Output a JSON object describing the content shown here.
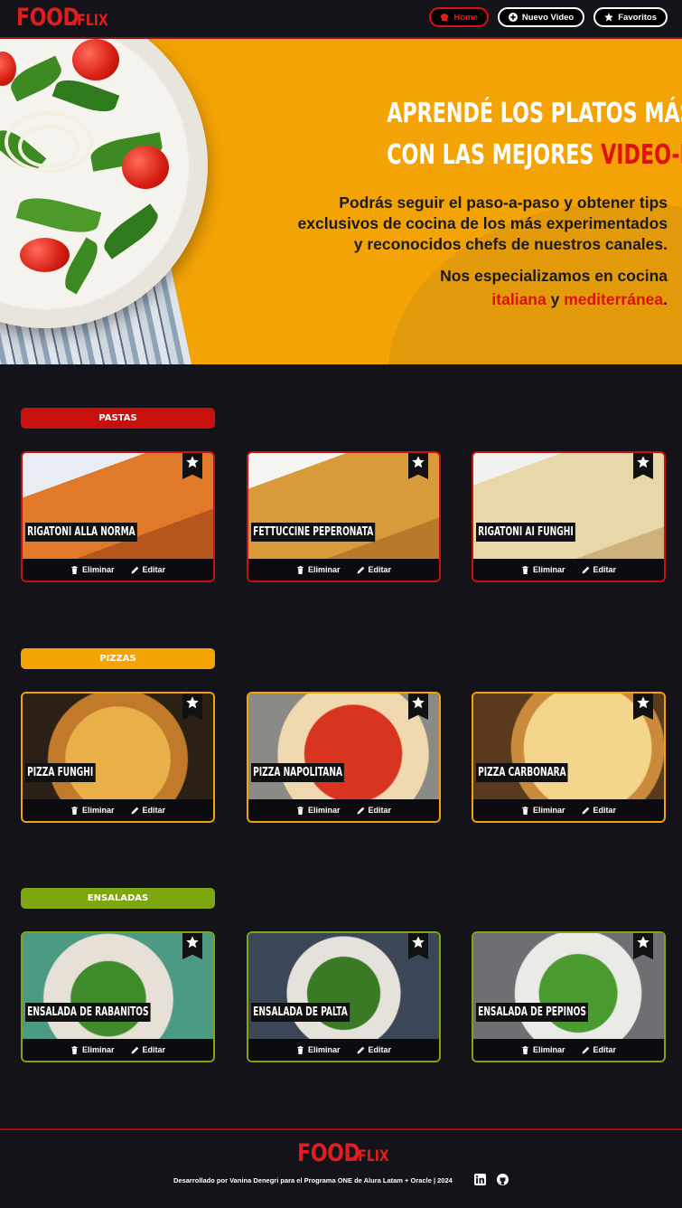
{
  "brand": {
    "food": "FOOD",
    "flix": ".FLIX",
    "red": "#e11d1d"
  },
  "nav": [
    {
      "label": "Home",
      "icon": "chef-hat-icon",
      "active": true
    },
    {
      "label": "Nuevo Video",
      "icon": "plus-circle-icon",
      "active": false
    },
    {
      "label": "Favoritos",
      "icon": "star-icon",
      "active": false
    }
  ],
  "hero": {
    "line1": "Aprendé los platos más ricos",
    "line2_a": "con las mejores ",
    "line2_b": "video-recetas",
    "paragraph": "Podrás seguir el paso-a-paso y obtener tips exclusivos de cocina de los más experimentados y reconocidos chefs de nuestros canales.",
    "spec_a": "Nos especializamos en cocina",
    "spec_b": "italiana",
    "spec_c": " y ",
    "spec_d": "mediterránea",
    "spec_e": "."
  },
  "categories": [
    {
      "name": "PASTAS",
      "color": "#c8100d",
      "cards": [
        {
          "title": "RIGATONI ALLA NORMA"
        },
        {
          "title": "FETTUCCINE PEPERONATA"
        },
        {
          "title": "RIGATONI AI FUNGHI"
        }
      ]
    },
    {
      "name": "PIZZAS",
      "color": "#f3a305",
      "cards": [
        {
          "title": "PIZZA FUNGHI"
        },
        {
          "title": "PIZZA NAPOLITANA"
        },
        {
          "title": "PIZZA CARBONARA"
        }
      ]
    },
    {
      "name": "ENSALADAS",
      "color": "#7ea70f",
      "cards": [
        {
          "title": "ENSALADA DE RABANITOS"
        },
        {
          "title": "ENSALADA DE PALTA"
        },
        {
          "title": "ENSALADA DE PEPINOS"
        }
      ]
    }
  ],
  "actions": {
    "delete": "Eliminar",
    "edit": "Editar"
  },
  "footer": {
    "credit": "Desarrollado por Vanina Denegri para el Programa ONE de Alura Latam + Oracle | 2024",
    "social": [
      "linkedin-icon",
      "github-icon"
    ]
  }
}
